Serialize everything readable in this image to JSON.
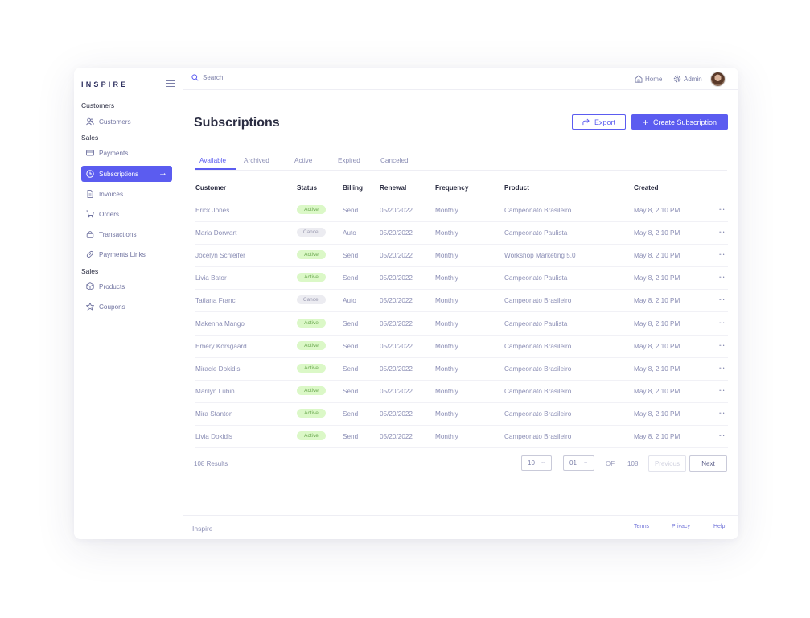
{
  "brand": "INSPIRE",
  "sidebar": {
    "sections": [
      {
        "title": "Customers",
        "items": [
          {
            "label": "Customers",
            "icon": "users-icon"
          }
        ]
      },
      {
        "title": "Sales",
        "items": [
          {
            "label": "Payments",
            "icon": "payments-icon"
          },
          {
            "label": "Subscriptions",
            "icon": "clock-icon",
            "active": true
          },
          {
            "label": "Invoices",
            "icon": "document-icon"
          },
          {
            "label": "Orders",
            "icon": "cart-icon"
          },
          {
            "label": "Transactions",
            "icon": "lock-icon"
          },
          {
            "label": "Payments Links",
            "icon": "link-icon"
          }
        ]
      },
      {
        "title": "Sales",
        "items": [
          {
            "label": "Products",
            "icon": "box-icon"
          },
          {
            "label": "Coupons",
            "icon": "star-icon"
          }
        ]
      }
    ]
  },
  "topbar": {
    "search_placeholder": "Search",
    "home_label": "Home",
    "admin_label": "Admin"
  },
  "page": {
    "title": "Subscriptions",
    "export_label": "Export",
    "create_label": "Create Subscription"
  },
  "tabs": [
    "Available",
    "Archived",
    "Active",
    "Expired",
    "Canceled"
  ],
  "table": {
    "headers": [
      "Customer",
      "Status",
      "Billing",
      "Renewal",
      "Frequency",
      "Product",
      "Created"
    ],
    "rows": [
      {
        "customer": "Erick Jones",
        "status": "Active",
        "billing": "Send",
        "renewal": "05/20/2022",
        "frequency": "Monthly",
        "product": "Campeonato Brasileiro",
        "created": "May 8, 2:10 PM"
      },
      {
        "customer": "Maria Dorwart",
        "status": "Cancel",
        "billing": "Auto",
        "renewal": "05/20/2022",
        "frequency": "Monthly",
        "product": "Campeonato Paulista",
        "created": "May 8, 2:10 PM"
      },
      {
        "customer": "Jocelyn Schleifer",
        "status": "Active",
        "billing": "Send",
        "renewal": "05/20/2022",
        "frequency": "Monthly",
        "product": "Workshop Marketing 5.0",
        "created": "May 8, 2:10 PM"
      },
      {
        "customer": "Livia Bator",
        "status": "Active",
        "billing": "Send",
        "renewal": "05/20/2022",
        "frequency": "Monthly",
        "product": "Campeonato Paulista",
        "created": "May 8, 2:10 PM"
      },
      {
        "customer": "Tatiana Franci",
        "status": "Cancel",
        "billing": "Auto",
        "renewal": "05/20/2022",
        "frequency": "Monthly",
        "product": "Campeonato Brasileiro",
        "created": "May 8, 2:10 PM"
      },
      {
        "customer": "Makenna Mango",
        "status": "Active",
        "billing": "Send",
        "renewal": "05/20/2022",
        "frequency": "Monthly",
        "product": "Campeonato Paulista",
        "created": "May 8, 2:10 PM"
      },
      {
        "customer": "Emery Korsgaard",
        "status": "Active",
        "billing": "Send",
        "renewal": "05/20/2022",
        "frequency": "Monthly",
        "product": "Campeonato Brasileiro",
        "created": "May 8, 2:10 PM"
      },
      {
        "customer": "Miracle Dokidis",
        "status": "Active",
        "billing": "Send",
        "renewal": "05/20/2022",
        "frequency": "Monthly",
        "product": "Campeonato Brasileiro",
        "created": "May 8, 2:10 PM"
      },
      {
        "customer": "Marilyn Lubin",
        "status": "Active",
        "billing": "Send",
        "renewal": "05/20/2022",
        "frequency": "Monthly",
        "product": "Campeonato Brasileiro",
        "created": "May 8, 2:10 PM"
      },
      {
        "customer": "Mira Stanton",
        "status": "Active",
        "billing": "Send",
        "renewal": "05/20/2022",
        "frequency": "Monthly",
        "product": "Campeonato Brasileiro",
        "created": "May 8, 2:10 PM"
      },
      {
        "customer": "Livia Dokidis",
        "status": "Active",
        "billing": "Send",
        "renewal": "05/20/2022",
        "frequency": "Monthly",
        "product": "Campeonato Brasileiro",
        "created": "May 8, 2:10 PM"
      }
    ]
  },
  "pagination": {
    "results": "108 Results",
    "per_page": "10",
    "page": "01",
    "of_label": "OF",
    "total_pages": "108",
    "previous_label": "Previous",
    "next_label": "Next"
  },
  "footer": {
    "brand": "Inspire",
    "links": [
      "Terms",
      "Privacy",
      "Help"
    ]
  },
  "colors": {
    "accent": "#5b5cf0",
    "active_badge_bg": "#dbf8c7",
    "active_badge_text": "#6aa84f",
    "cancel_badge_bg": "#ececf1"
  }
}
